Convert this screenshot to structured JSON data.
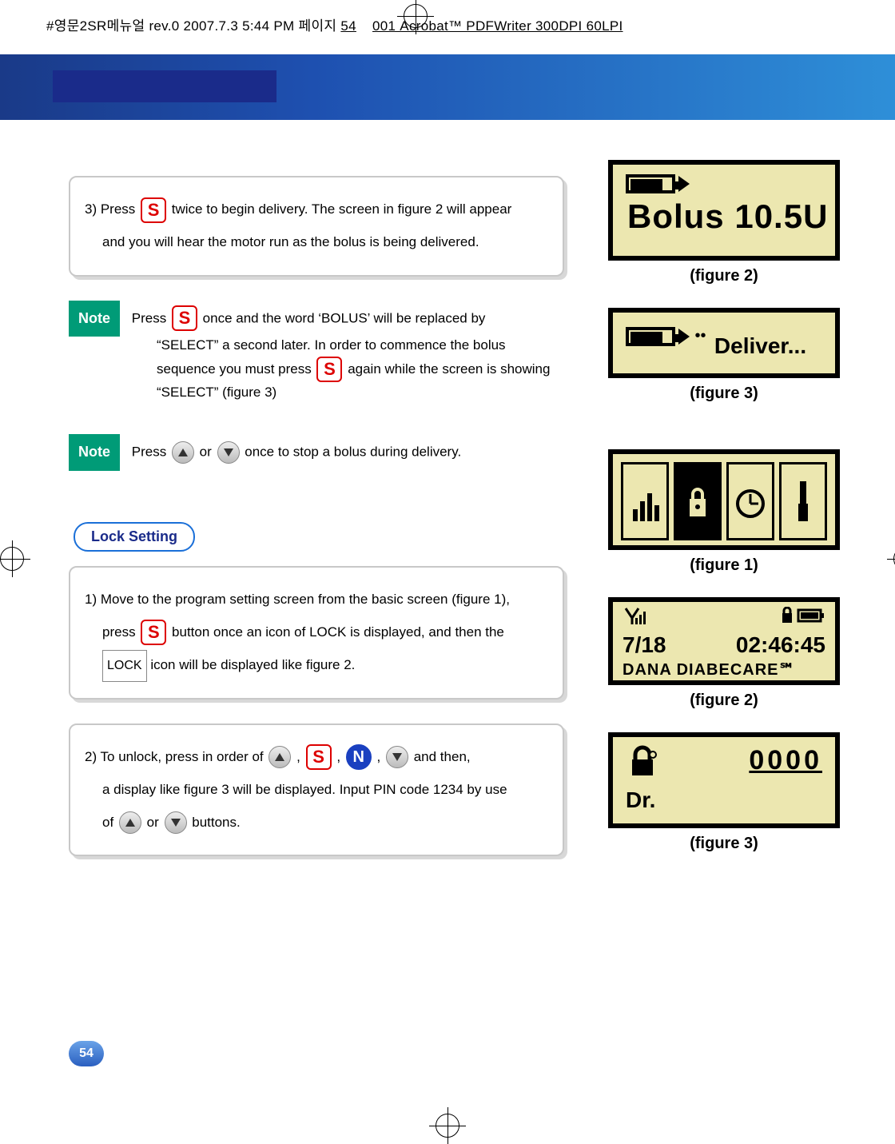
{
  "header": {
    "text_left": "#영문2SR메뉴얼   rev.0   2007.7.3 5:44 PM   페이지",
    "page_in_header": "54",
    "text_right": "001 Acrobat™ PDFWriter 300DPI 60LPI"
  },
  "page_number": "54",
  "step3": {
    "pre": "3) Press",
    "mid": "twice to begin delivery. The screen in figure 2 will appear",
    "line2": "and you will hear the motor run as the bolus is being delivered."
  },
  "note1": {
    "label": "Note",
    "a": "Press",
    "b": "once and the word ‘BOLUS’ will be replaced by",
    "l2": "“SELECT” a second later. In order to commence the bolus",
    "l3a": "sequence you must press",
    "l3b": "again while the screen is showing",
    "l4": "“SELECT” (figure 3)"
  },
  "note2": {
    "label": "Note",
    "a": "Press",
    "b": "or",
    "c": "once to stop a bolus during delivery."
  },
  "section": {
    "title": "Lock Setting"
  },
  "step1_lock": {
    "l1": "1) Move to the program setting screen from the basic screen (figure 1),",
    "l2a": "press",
    "l2b": "button once an icon of LOCK is displayed, and then the",
    "lock_word": "LOCK",
    "l3": "icon will be displayed like figure 2."
  },
  "step2_lock": {
    "l1a": "2) To unlock, press in order of",
    "l1b": ",",
    "l1c": ",",
    "l1d": ",",
    "l1e": "and then,",
    "l2": "a display like figure 3 will be displayed. Input PIN code 1234 by use",
    "l3a": "of",
    "l3b": "or",
    "l3c": "buttons."
  },
  "figures": {
    "fig2a": "(figure 2)",
    "fig3a": "(figure 3)",
    "fig1": "(figure 1)",
    "fig2b": "(figure 2)",
    "fig3b": "(figure 3)"
  },
  "screens": {
    "bolus": "Bolus  10.5U",
    "deliver": "Deliver...",
    "home_date": "7/18",
    "home_time": "02:46:45",
    "home_brand": "DANA DIABECARE℠",
    "pin_value": "0000",
    "pin_dr": "Dr."
  },
  "icons": {
    "s": "S",
    "n": "N"
  }
}
